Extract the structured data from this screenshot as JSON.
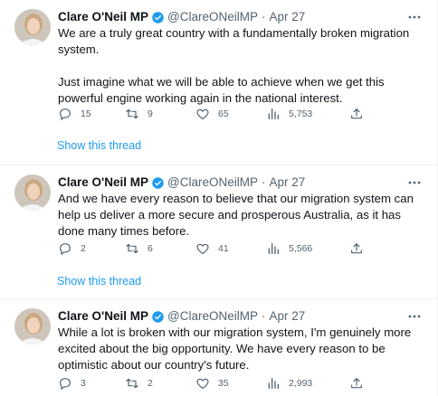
{
  "tweets": [
    {
      "author": "Clare O'Neil MP",
      "handle": "@ClareONeilMP",
      "separator": "·",
      "date": "Apr 27",
      "paragraphs": [
        "We are a truly great country with a fundamentally broken migration system.",
        "Just imagine what we will be able to achieve when we get this powerful engine working again in the national interest."
      ],
      "replies": "15",
      "retweets": "9",
      "likes": "65",
      "views": "5,753",
      "show_thread": "Show this thread"
    },
    {
      "author": "Clare O'Neil MP",
      "handle": "@ClareONeilMP",
      "separator": "·",
      "date": "Apr 27",
      "paragraphs": [
        "And we have every reason to believe that our migration system can help us deliver a more secure and prosperous Australia, as it has done many times before."
      ],
      "replies": "2",
      "retweets": "6",
      "likes": "41",
      "views": "5,566",
      "show_thread": "Show this thread"
    },
    {
      "author": "Clare O'Neil MP",
      "handle": "@ClareONeilMP",
      "separator": "·",
      "date": "Apr 27",
      "paragraphs": [
        "While a lot is broken with our migration system, I'm genuinely more excited about the big opportunity. We have every reason to be optimistic about our country's future."
      ],
      "replies": "3",
      "retweets": "2",
      "likes": "35",
      "views": "2,993"
    }
  ],
  "colors": {
    "text": "#0f1419",
    "secondary": "#536471",
    "link": "#1d9bf0",
    "verified": "#1d9bf0",
    "divider": "#eff3f4"
  },
  "icons": [
    "more-icon",
    "reply-icon",
    "retweet-icon",
    "like-icon",
    "views-icon",
    "share-icon",
    "verified-badge-icon"
  ]
}
